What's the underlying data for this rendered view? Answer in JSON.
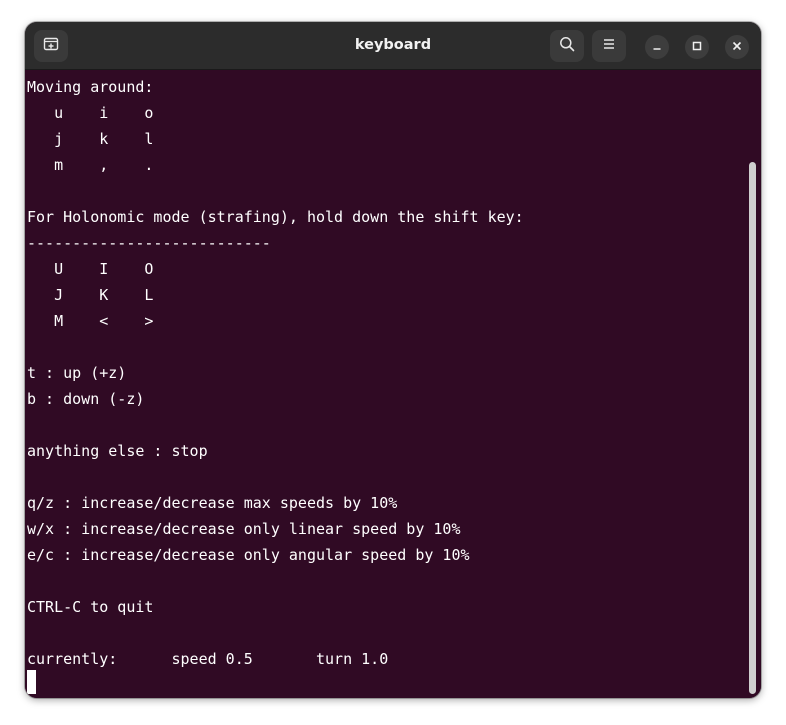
{
  "window": {
    "title": "keyboard",
    "icons": {
      "new_tab": "new-tab-icon",
      "search": "search-icon",
      "menu": "hamburger-menu-icon",
      "minimize": "minimize-icon",
      "maximize": "maximize-icon",
      "close": "close-icon"
    }
  },
  "terminal": {
    "lines": [
      "Moving around:",
      "   u    i    o",
      "   j    k    l",
      "   m    ,    .",
      "",
      "For Holonomic mode (strafing), hold down the shift key:",
      "---------------------------",
      "   U    I    O",
      "   J    K    L",
      "   M    <    >",
      "",
      "t : up (+z)",
      "b : down (-z)",
      "",
      "anything else : stop",
      "",
      "q/z : increase/decrease max speeds by 10%",
      "w/x : increase/decrease only linear speed by 10%",
      "e/c : increase/decrease only angular speed by 10%",
      "",
      "CTRL-C to quit",
      "",
      "currently:      speed 0.5       turn 1.0"
    ]
  },
  "colors": {
    "terminal_bg": "#300a24",
    "terminal_fg": "#ffffff",
    "titlebar_bg": "#2c2c2c"
  }
}
